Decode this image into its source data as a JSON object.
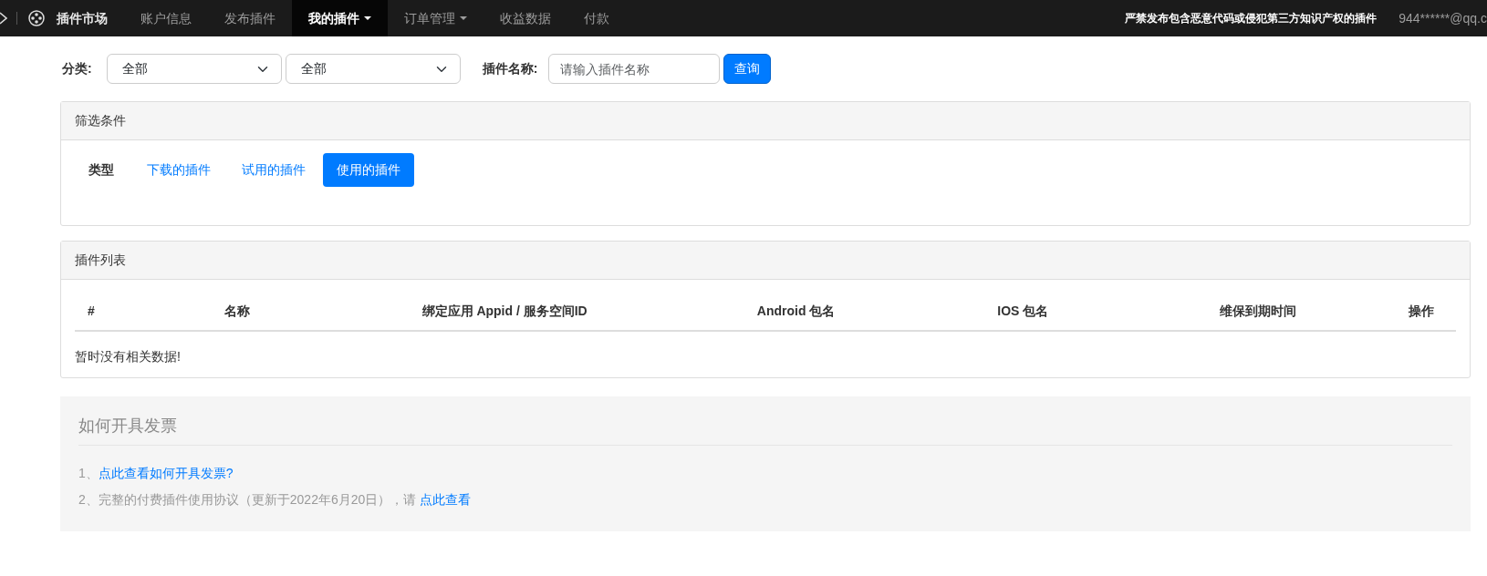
{
  "navbar": {
    "brand": "插件市场",
    "items": [
      {
        "label": "账户信息",
        "selected": false,
        "dropdown": false
      },
      {
        "label": "发布插件",
        "selected": false,
        "dropdown": false
      },
      {
        "label": "我的插件",
        "selected": true,
        "dropdown": true
      },
      {
        "label": "订单管理",
        "selected": false,
        "dropdown": true
      },
      {
        "label": "收益数据",
        "selected": false,
        "dropdown": false
      },
      {
        "label": "付款",
        "selected": false,
        "dropdown": false
      }
    ],
    "notice": "严禁发布包含恶意代码或侵犯第三方知识产权的插件",
    "user": "944******@qq.c"
  },
  "search": {
    "category_label": "分类:",
    "category_1": "全部",
    "category_2": "全部",
    "name_label": "插件名称:",
    "name_placeholder": "请输入插件名称",
    "button": "查询"
  },
  "filter_panel": {
    "title": "筛选条件",
    "type_label": "类型",
    "options": [
      {
        "label": "下载的插件",
        "selected": false
      },
      {
        "label": "试用的插件",
        "selected": false
      },
      {
        "label": "使用的插件",
        "selected": true
      }
    ]
  },
  "table": {
    "title": "插件列表",
    "columns": [
      "#",
      "名称",
      "绑定应用 Appid / 服务空间ID",
      "Android 包名",
      "IOS 包名",
      "维保到期时间",
      "操作"
    ],
    "empty_message": "暂时没有相关数据!"
  },
  "invoice": {
    "title": "如何开具发票",
    "notes": [
      {
        "text": "1、",
        "link": "点此查看如何开具发票?"
      },
      {
        "text": "2、完整的付费插件使用协议（更新于2022年6月20日），请 ",
        "link": "点此查看"
      }
    ]
  }
}
